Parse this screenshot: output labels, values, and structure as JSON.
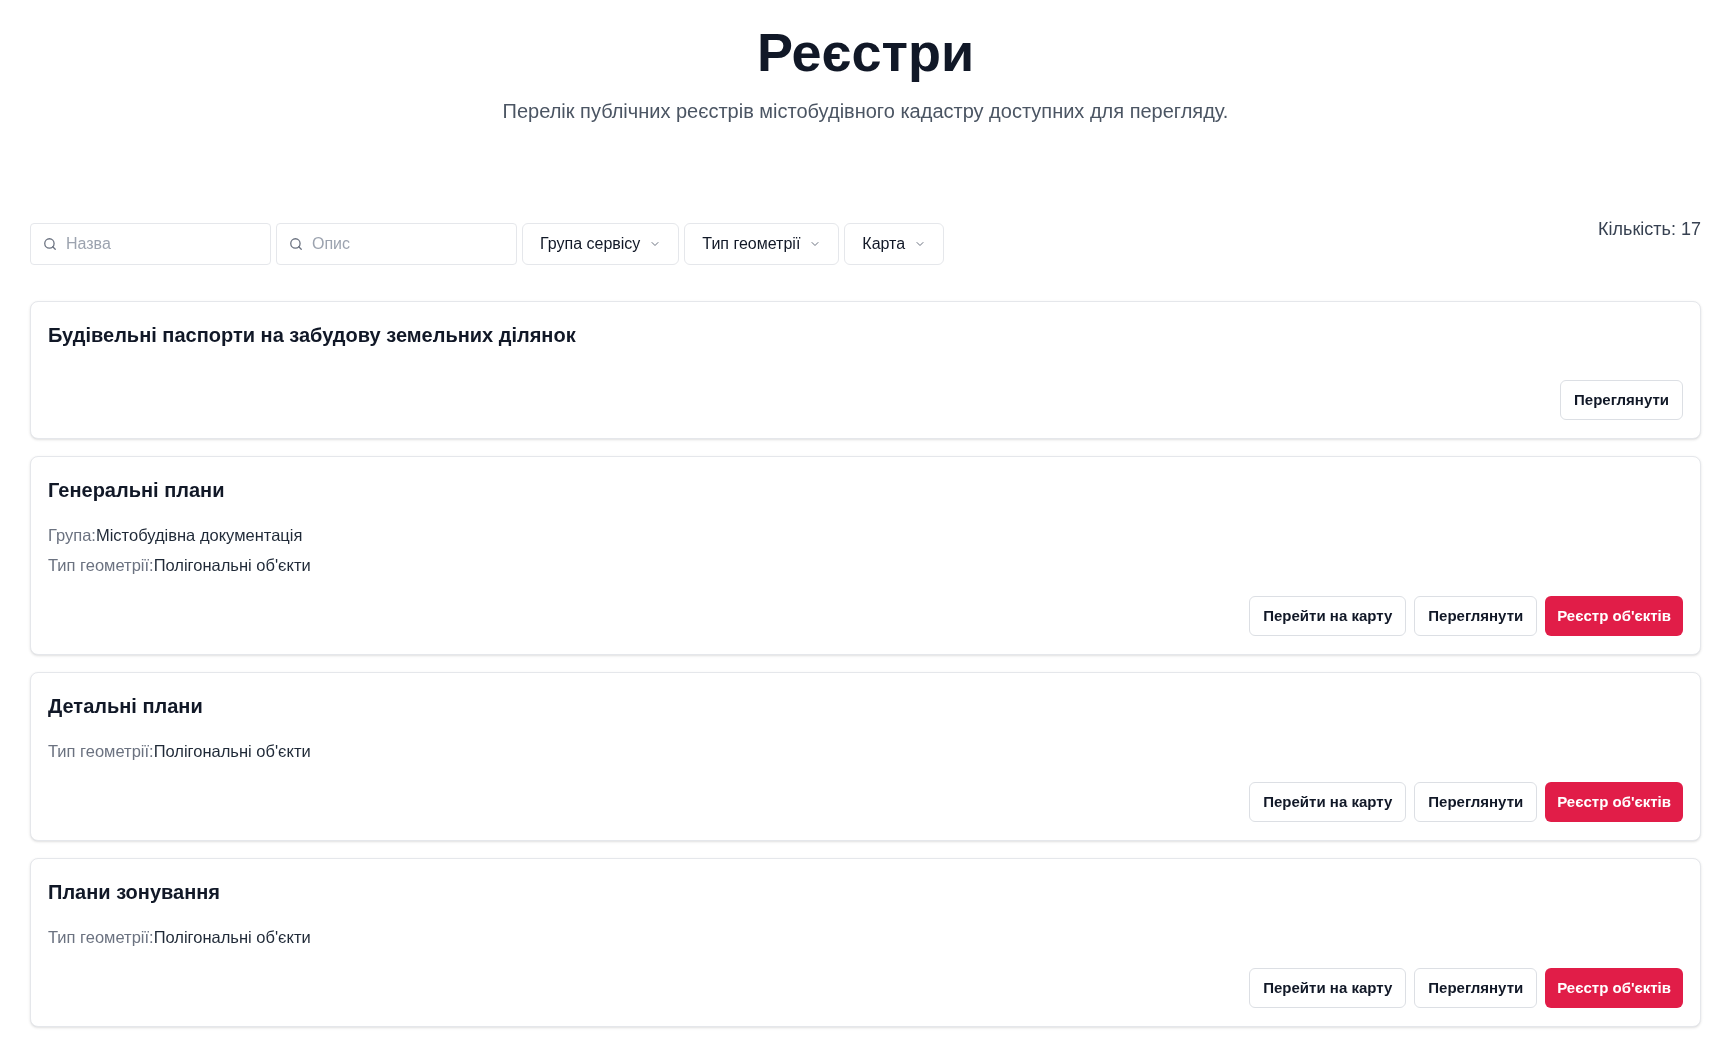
{
  "header": {
    "title": "Реєстри",
    "subtitle": "Перелік публічних реєстрів містобудівного кадастру доступних для перегляду."
  },
  "filters": {
    "search_fields": [
      {
        "placeholder": "Назва"
      },
      {
        "placeholder": "Опис"
      }
    ],
    "dropdowns": [
      {
        "label": "Група сервісу"
      },
      {
        "label": "Тип геометрії"
      },
      {
        "label": "Карта"
      }
    ]
  },
  "count": "Кількість: 17",
  "registries": [
    {
      "title": "Будівельні паспорти на забудову земельних ділянок",
      "buttons": [
        {
          "label": "Переглянути",
          "kind": "outline"
        }
      ]
    },
    {
      "title": "Генеральні плани",
      "details": [
        {
          "label": "Група:",
          "value": "Містобудівна документація"
        },
        {
          "label": "Тип геометрії:",
          "value": "Полігональні об'єкти"
        }
      ],
      "buttons": [
        {
          "label": "Перейти на карту",
          "kind": "outline"
        },
        {
          "label": "Переглянути",
          "kind": "outline"
        },
        {
          "label": "Реєстр об'єктів",
          "kind": "primary"
        }
      ]
    },
    {
      "title": "Детальні плани",
      "details": [
        {
          "label": "Тип геометрії:",
          "value": "Полігональні об'єкти"
        }
      ],
      "buttons": [
        {
          "label": "Перейти на карту",
          "kind": "outline"
        },
        {
          "label": "Переглянути",
          "kind": "outline"
        },
        {
          "label": "Реєстр об'єктів",
          "kind": "primary"
        }
      ]
    },
    {
      "title": "Плани зонування",
      "details": [
        {
          "label": "Тип геометрії:",
          "value": "Полігональні об'єкти"
        }
      ],
      "buttons": [
        {
          "label": "Перейти на карту",
          "kind": "outline"
        },
        {
          "label": "Переглянути",
          "kind": "outline"
        },
        {
          "label": "Реєстр об'єктів",
          "kind": "primary"
        }
      ]
    }
  ]
}
